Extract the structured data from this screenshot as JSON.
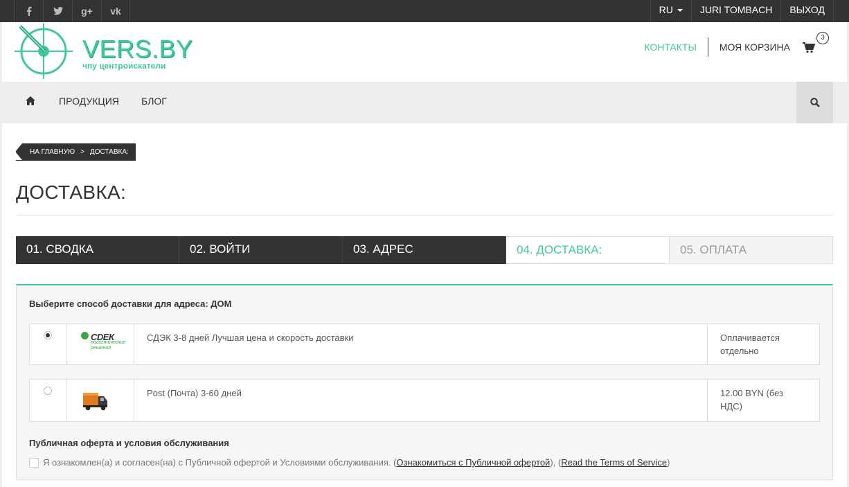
{
  "topbar": {
    "social": [
      {
        "icon": "facebook-icon",
        "glyph": "f"
      },
      {
        "icon": "twitter-icon",
        "glyph": "t"
      },
      {
        "icon": "google-plus-icon",
        "glyph": "g+"
      },
      {
        "icon": "vk-icon",
        "glyph": "vk"
      }
    ],
    "language": "RU",
    "user": "JURI TOMBACH",
    "logout": "ВЫХОД"
  },
  "header": {
    "logo_title": "VERS.BY",
    "logo_subtitle": "чпу центроискатели",
    "contacts": "КОНТАКТЫ",
    "my_cart": "МОЯ КОРЗИНА",
    "cart_count": "3"
  },
  "nav": {
    "items": [
      "ПРОДУКЦИЯ",
      "БЛОГ"
    ]
  },
  "breadcrumb": {
    "home": "НА ГЛАВНУЮ",
    "separator": ">",
    "current": "ДОСТАВКА:"
  },
  "page_title": "ДОСТАВКА:",
  "steps": [
    {
      "label": "01. СВОДКА",
      "state": "done"
    },
    {
      "label": "02. ВОЙТИ",
      "state": "done"
    },
    {
      "label": "03. АДРЕС",
      "state": "done"
    },
    {
      "label": "04. ДОСТАВКА:",
      "state": "current"
    },
    {
      "label": "05. ОПЛАТА",
      "state": "todo"
    }
  ],
  "delivery": {
    "title": "Выберите способ доставки для адреса: ДОМ",
    "options": [
      {
        "selected": true,
        "logo_name": "СDЕК",
        "logo_sub": "логистические решения",
        "description": "СДЭК 3-8 дней Лучшая цена и скорость доставки",
        "price": "Оплачивается отдельно"
      },
      {
        "selected": false,
        "logo_icon": "truck-icon",
        "description": "Post (Почта) 3-60 дней",
        "price": "12.00 BYN (без НДС)"
      }
    ]
  },
  "terms": {
    "title": "Публичная оферта и условия обслуживания",
    "text": "Я ознакомлен(а) и согласен(на) с Публичной офертой и Условиями обслуживания. (",
    "link1": "Ознакомиться с Публичной офертой",
    "mid": "), (",
    "link2": "Read the Terms of Service",
    "end": ")"
  },
  "colors": {
    "accent": "#3ec8a0",
    "dark": "#333333",
    "light_bg": "#eeeeee"
  }
}
